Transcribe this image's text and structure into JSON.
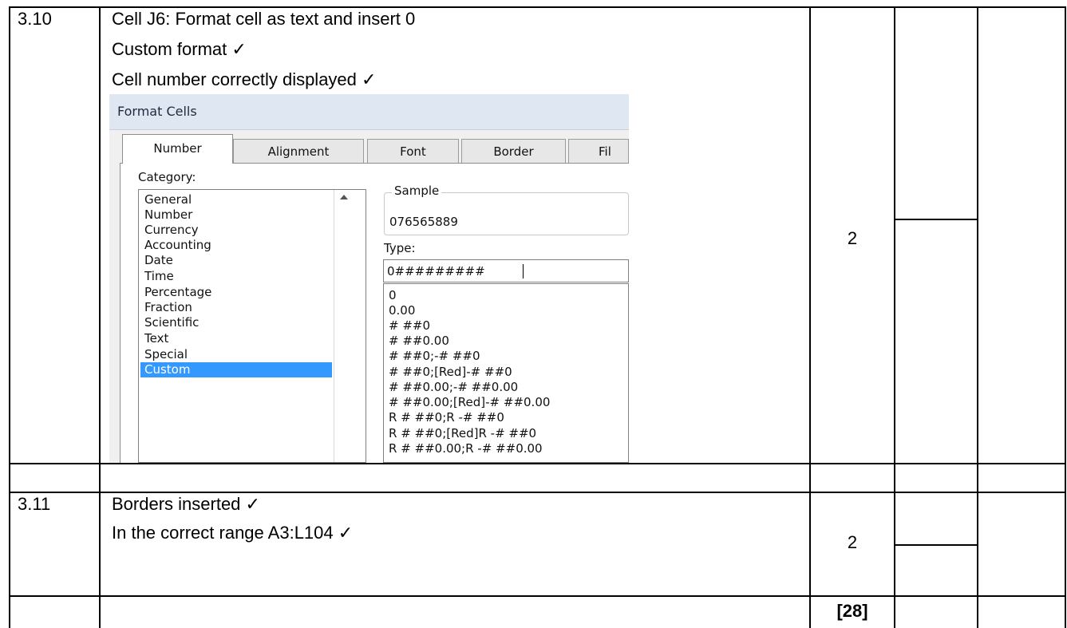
{
  "rows": [
    {
      "question": "3.10",
      "lines": [
        "Cell J6: Format cell as text and insert 0",
        "Custom format ✓",
        "Cell number correctly displayed ✓"
      ],
      "marks": "2"
    },
    {
      "question": "3.11",
      "lines": [
        "Borders inserted ✓",
        "In the correct range A3:L104 ✓"
      ],
      "marks": "2"
    }
  ],
  "total": "[28]",
  "dialog": {
    "title": "Format Cells",
    "tabs": [
      "Number",
      "Alignment",
      "Font",
      "Border",
      "Fil"
    ],
    "active_tab": "Number",
    "category_label": "Category:",
    "categories": [
      "General",
      "Number",
      "Currency",
      "Accounting",
      "Date",
      "Time",
      "Percentage",
      "Fraction",
      "Scientific",
      "Text",
      "Special",
      "Custom"
    ],
    "selected_category": "Custom",
    "sample_label": "Sample",
    "sample_value": "076565889",
    "type_label": "Type:",
    "type_value": "0#########",
    "type_list": [
      "0",
      "0.00",
      "# ##0",
      "# ##0.00",
      "# ##0;-# ##0",
      "# ##0;[Red]-# ##0",
      "# ##0.00;-# ##0.00",
      "# ##0.00;[Red]-# ##0.00",
      "R # ##0;R -# ##0",
      "R # ##0;[Red]R -# ##0",
      "R # ##0.00;R -# ##0.00"
    ]
  }
}
